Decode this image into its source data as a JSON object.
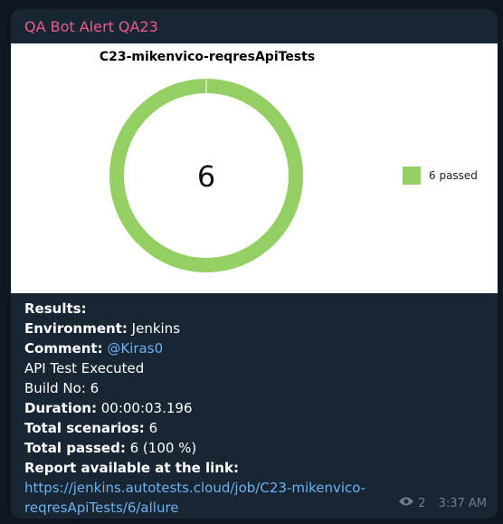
{
  "message": {
    "sender": "QA Bot Alert QA23",
    "lines": {
      "results_label": "Results:",
      "environment_label": "Environment:",
      "environment_value": "Jenkins",
      "comment_label": "Comment:",
      "comment_value": "@Kiras0",
      "api_line": "API Test Executed",
      "build_line": "Build No: 6",
      "duration_label": "Duration:",
      "duration_value": "00:00:03.196",
      "total_scenarios_label": "Total scenarios:",
      "total_scenarios_value": "6",
      "total_passed_label": "Total passed:",
      "total_passed_value": "6 (100 %)",
      "report_label": "Report available at the link:",
      "report_url_line1": "https://jenkins.autotests.cloud/job/C23-mikenvico-",
      "report_url_line2": "reqresApiTests/6/allure"
    },
    "views": "2",
    "time": "3:37 AM"
  },
  "chart_data": {
    "type": "pie",
    "title": "C23-mikenvico-reqresApiTests",
    "center_label": "6",
    "slices": [
      {
        "label": "6 passed",
        "value": 6,
        "color": "#94cf63"
      }
    ],
    "legend": "right"
  },
  "icons": {
    "views": "eye-icon"
  },
  "colors": {
    "background": "#0e1621",
    "bubble": "#182533",
    "sender": "#e85e8b",
    "link": "#6ab2f2",
    "meta": "#6d7f8f"
  }
}
